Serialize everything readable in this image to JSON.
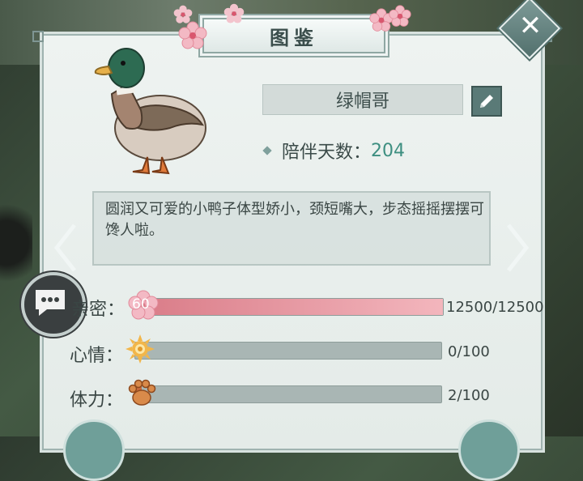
{
  "window": {
    "title": "图鉴"
  },
  "pet": {
    "name": "绿帽哥",
    "days_label": "陪伴天数：",
    "days_value": "204",
    "description": "圆润又可爱的小鸭子体型娇小，颈短嘴大，步态摇摇摆摆可馋人啦。"
  },
  "stats": [
    {
      "label": "亲密：",
      "badge_text": "60",
      "value_text": "12500/12500",
      "fill": 1.0,
      "color": "#e79aa2"
    },
    {
      "label": "心情：",
      "value_text": "0/100",
      "fill": 0.0,
      "color": "#e6b24a"
    },
    {
      "label": "体力：",
      "value_text": "2/100",
      "fill": 0.02,
      "color": "#c96b3c"
    }
  ],
  "icons": {
    "close": "close-icon",
    "edit": "pencil-icon",
    "chat": "chat-icon",
    "prev": "chevron-left-icon",
    "next": "chevron-right-icon"
  },
  "colors": {
    "accent": "#3d8f80",
    "panel": "#e9efed",
    "frame": "#9fb3b0"
  }
}
